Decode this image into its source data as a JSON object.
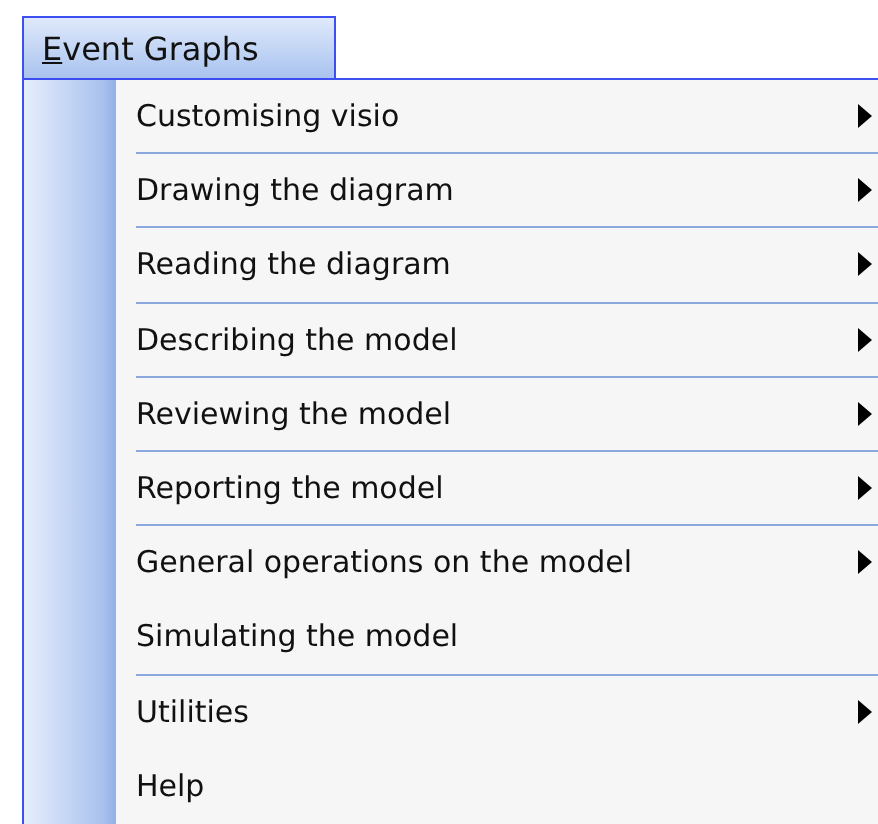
{
  "menu_title": {
    "label": "Event Graphs",
    "mnemonic": true
  },
  "items": [
    {
      "label": "Customising visio",
      "has_submenu": true,
      "divider_below": true
    },
    {
      "label": "Drawing the diagram",
      "has_submenu": true,
      "divider_below": true
    },
    {
      "label": "Reading the diagram",
      "has_submenu": true,
      "divider_below": true
    },
    {
      "label": "Describing the model",
      "has_submenu": true,
      "divider_below": true
    },
    {
      "label": "Reviewing the model",
      "has_submenu": true,
      "divider_below": true
    },
    {
      "label": "Reporting the model",
      "has_submenu": true,
      "divider_below": true
    },
    {
      "label": "General operations on the model",
      "has_submenu": true,
      "divider_below": false
    },
    {
      "label": "Simulating the model",
      "has_submenu": false,
      "divider_below": true
    },
    {
      "label": "Utilities",
      "has_submenu": true,
      "divider_below": false
    },
    {
      "label": "Help",
      "has_submenu": false,
      "divider_below": false
    }
  ]
}
